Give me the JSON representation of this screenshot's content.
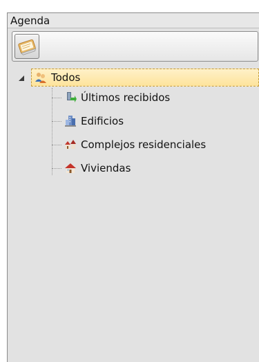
{
  "panel": {
    "title": "Agenda"
  },
  "toolbar": {
    "button_icon": "address-book-icon"
  },
  "tree": {
    "root": {
      "label": "Todos",
      "icon": "people-icon",
      "expanded": true
    },
    "children": [
      {
        "label": "Últimos recibidos",
        "icon": "recent-download-icon"
      },
      {
        "label": "Edificios",
        "icon": "building-icon"
      },
      {
        "label": "Complejos residenciales",
        "icon": "residential-complex-icon"
      },
      {
        "label": "Viviendas",
        "icon": "house-icon"
      }
    ]
  },
  "colors": {
    "selection_bg": "#fde39b",
    "selection_border": "#c49b3a",
    "panel_bg": "#e2e2e2"
  }
}
